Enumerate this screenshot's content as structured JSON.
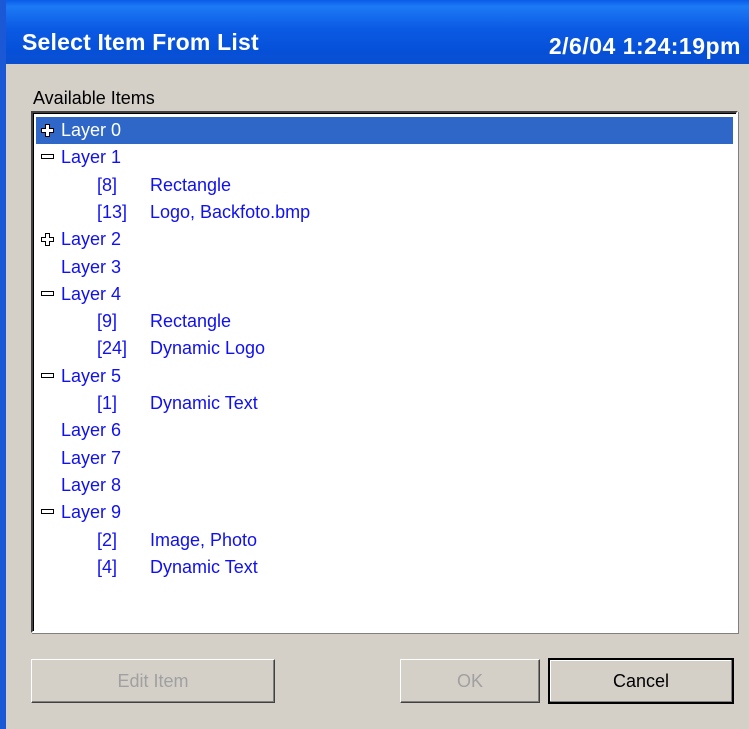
{
  "window": {
    "title": "Select Item From List",
    "datetime": "2/6/04 1:24:19pm"
  },
  "list": {
    "label": "Available Items",
    "rows": [
      {
        "kind": "layer",
        "expander": "plus",
        "label": "Layer 0",
        "selected": true
      },
      {
        "kind": "layer",
        "expander": "minus",
        "label": "Layer 1"
      },
      {
        "kind": "item",
        "index": "[8]",
        "label": "Rectangle"
      },
      {
        "kind": "item",
        "index": "[13]",
        "label": "Logo, Backfoto.bmp"
      },
      {
        "kind": "layer",
        "expander": "plus",
        "label": "Layer 2"
      },
      {
        "kind": "layer",
        "expander": "none",
        "label": "Layer 3"
      },
      {
        "kind": "layer",
        "expander": "minus",
        "label": "Layer 4"
      },
      {
        "kind": "item",
        "index": "[9]",
        "label": "Rectangle"
      },
      {
        "kind": "item",
        "index": "[24]",
        "label": "Dynamic Logo"
      },
      {
        "kind": "layer",
        "expander": "minus",
        "label": "Layer 5"
      },
      {
        "kind": "item",
        "index": "[1]",
        "label": "Dynamic Text"
      },
      {
        "kind": "layer",
        "expander": "none",
        "label": "Layer 6"
      },
      {
        "kind": "layer",
        "expander": "none",
        "label": "Layer 7"
      },
      {
        "kind": "layer",
        "expander": "none",
        "label": "Layer 8"
      },
      {
        "kind": "layer",
        "expander": "minus",
        "label": "Layer 9"
      },
      {
        "kind": "item",
        "index": "[2]",
        "label": "Image, Photo"
      },
      {
        "kind": "item",
        "index": "[4]",
        "label": "Dynamic Text"
      }
    ]
  },
  "buttons": {
    "edit_item": {
      "label": "Edit Item",
      "enabled": false
    },
    "ok": {
      "label": "OK",
      "enabled": false
    },
    "cancel": {
      "label": "Cancel",
      "enabled": true
    }
  },
  "colors": {
    "titlebar": "#0a5ce8",
    "item_text": "#1010f0",
    "selection": "#2f67c9",
    "face": "#d4d0c8"
  }
}
